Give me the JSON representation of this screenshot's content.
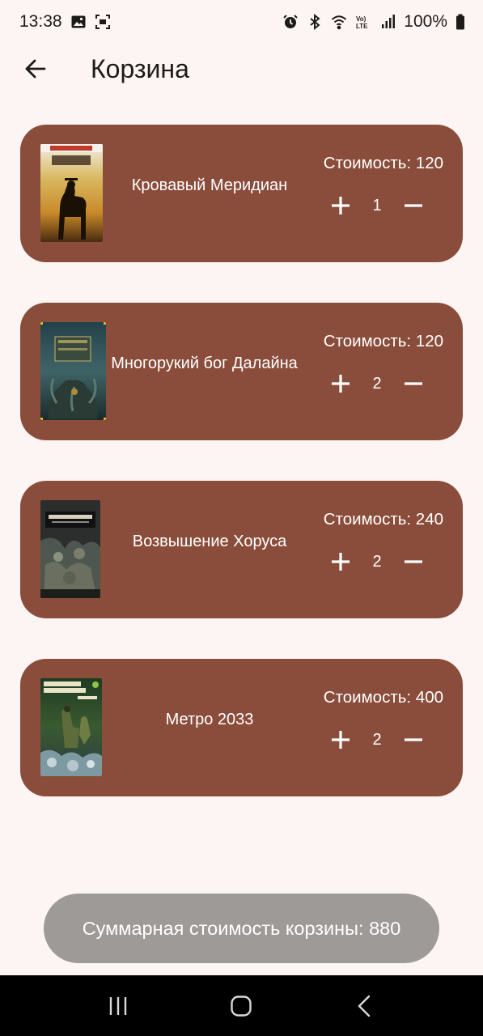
{
  "status_bar": {
    "time": "13:38",
    "battery": "100%",
    "icons": [
      "image-icon",
      "screenshot-icon",
      "alarm-icon",
      "bluetooth-icon",
      "wifi-icon",
      "volte-icon",
      "signal-icon",
      "battery-icon"
    ]
  },
  "header": {
    "title": "Корзина",
    "back_icon": "arrow-back-icon"
  },
  "cart": {
    "items": [
      {
        "title": "Кровавый Меридиан",
        "price": "Стоимость: 120",
        "quantity": "1"
      },
      {
        "title": "Многорукий бог Далайна",
        "price": "Стоимость: 120",
        "quantity": "2"
      },
      {
        "title": "Возвышение Хоруса",
        "price": "Стоимость: 240",
        "quantity": "2"
      },
      {
        "title": "Метро 2033",
        "price": "Стоимость: 400",
        "quantity": "2"
      }
    ],
    "total": "Суммарная стоимость корзины: 880"
  },
  "nav_bar": {
    "icons": [
      "recent-apps-icon",
      "home-icon",
      "back-icon"
    ]
  },
  "colors": {
    "background": "#fdf5f3",
    "card": "#8b4d3b",
    "total_pill": "#9e9a98",
    "text_on_card": "#ffffff"
  }
}
